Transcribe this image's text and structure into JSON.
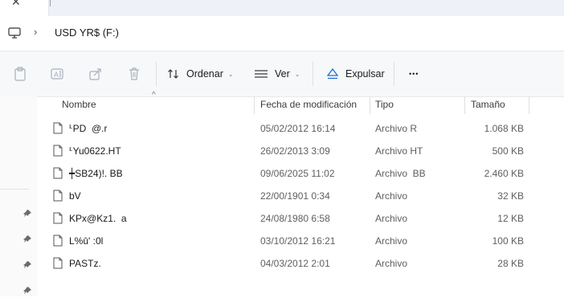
{
  "tab": {
    "close_glyph": "✕"
  },
  "address": {
    "chevron": "›",
    "crumb": "USD YR$ (F:)"
  },
  "toolbar": {
    "sort_label": "Ordenar",
    "view_label": "Ver",
    "eject_label": "Expulsar",
    "more_glyph": "•••",
    "caret_glyph": "⌄"
  },
  "columns": {
    "name": "Nombre",
    "date": "Fecha de modificación",
    "type": "Tipo",
    "size": "Tamaño",
    "sort_glyph": "^"
  },
  "files": [
    {
      "name": "ᒻPD  @.r",
      "date": "05/02/2012 16:14",
      "type": "Archivo R",
      "size": "1.068 KB"
    },
    {
      "name": "ᒻYu0622.HT",
      "date": "26/02/2013 3:09",
      "type": "Archivo HT",
      "size": "500 KB"
    },
    {
      "name": "┿SB24)!. BB",
      "date": "09/06/2025 11:02",
      "type": "Archivo  BB",
      "size": "2.460 KB"
    },
    {
      "name": "bV",
      "date": "22/00/1901 0:34",
      "type": "Archivo",
      "size": "32 KB"
    },
    {
      "name": "KPx@Kz1.  a",
      "date": "24/08/1980 6:58",
      "type": "Archivo",
      "size": "12 KB"
    },
    {
      "name": "L%ū' :0l",
      "date": "03/10/2012 16:21",
      "type": "Archivo",
      "size": "100 KB"
    },
    {
      "name": "PASTz.",
      "date": "04/03/2012 2:01",
      "type": "Archivo",
      "size": "28 KB"
    }
  ]
}
